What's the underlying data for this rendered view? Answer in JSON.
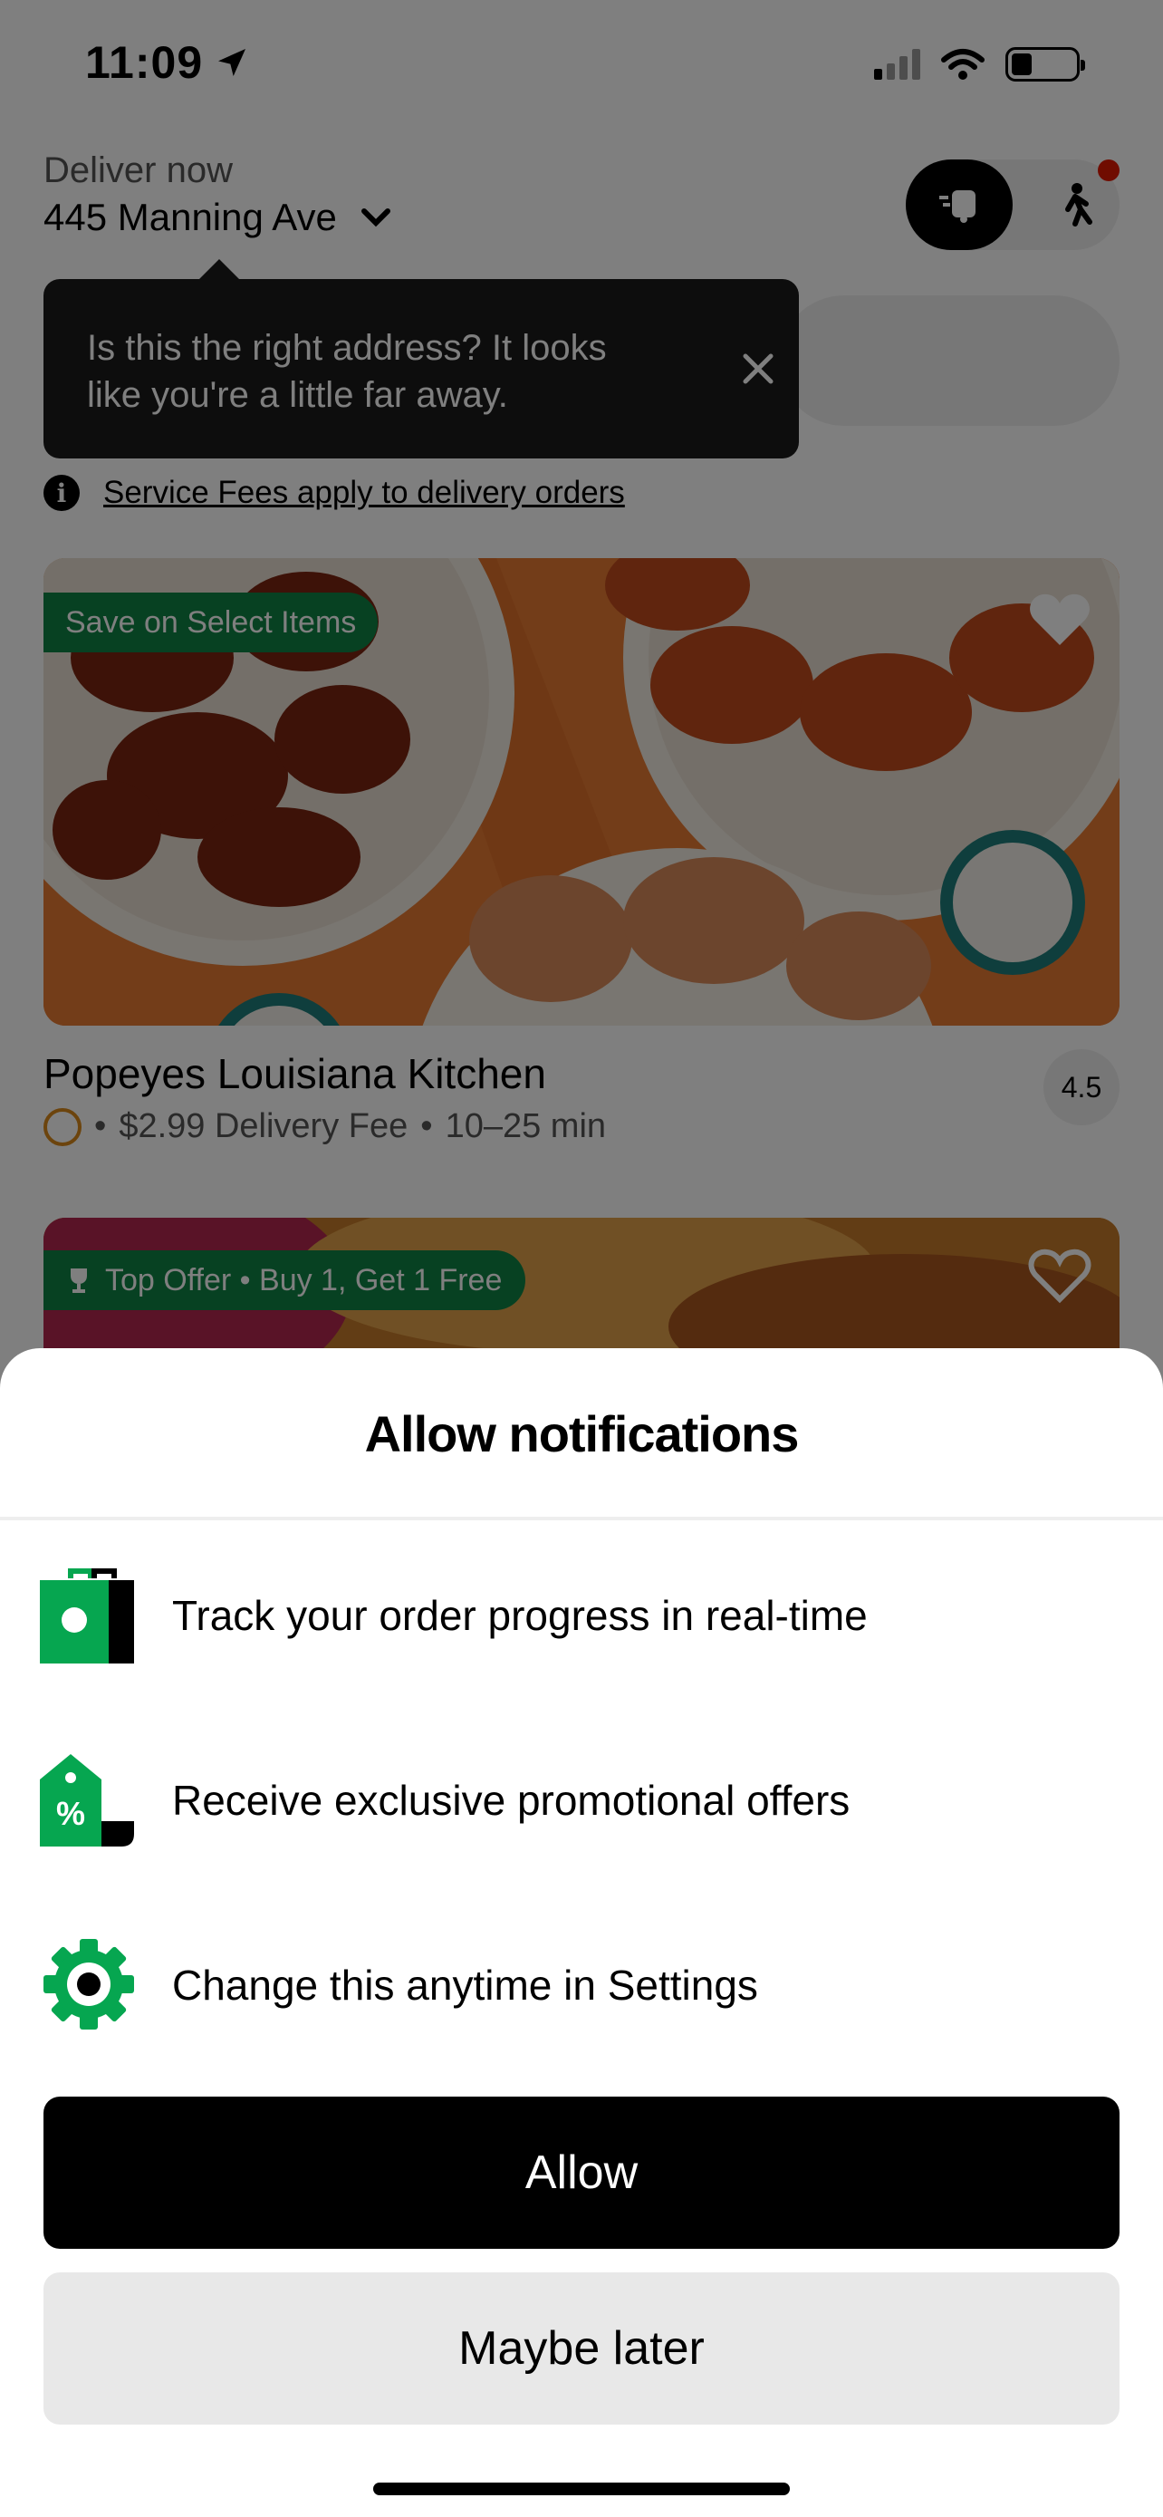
{
  "status_bar": {
    "time": "11:09",
    "icons": [
      "location-arrow-icon",
      "cellular-signal-icon",
      "wifi-icon",
      "battery-icon"
    ]
  },
  "header": {
    "deliver_label": "Deliver now",
    "address": "445 Manning Ave",
    "mode_toggle": {
      "selected": "delivery",
      "delivery_icon": "delivery-icon",
      "pickup_icon": "pickup-walking-icon"
    }
  },
  "tooltip": {
    "text": "Is this the right address? It looks like you're a little far away.",
    "close_icon": "close-icon"
  },
  "fees_notice": "Service Fees apply to delivery orders",
  "stores": [
    {
      "promo": "Save on Select Items",
      "name": "Popeyes Louisiana Kitchen",
      "delivery_fee": "$2.99 Delivery Fee",
      "time": "10–25 min",
      "rating": "4.5",
      "favorite_icon": "heart-icon"
    },
    {
      "promo": "Top Offer • Buy 1, Get 1 Free",
      "promo_icon": "trophy-icon",
      "favorite_icon": "heart-outline-icon"
    }
  ],
  "sheet": {
    "title": "Allow notifications",
    "benefits": [
      {
        "icon": "shopping-bag-icon",
        "text": "Track your order progress in real-time"
      },
      {
        "icon": "discount-tag-icon",
        "text": "Receive exclusive promotional offers"
      },
      {
        "icon": "gear-icon",
        "text": "Change this anytime in Settings"
      }
    ],
    "allow_label": "Allow",
    "later_label": "Maybe later"
  },
  "colors": {
    "brand_green": "#0e8345",
    "icon_green": "#06a650",
    "primary_button": "#000000",
    "secondary_button": "#e8e8e8",
    "overlay": "rgba(0,0,0,0.5)"
  }
}
